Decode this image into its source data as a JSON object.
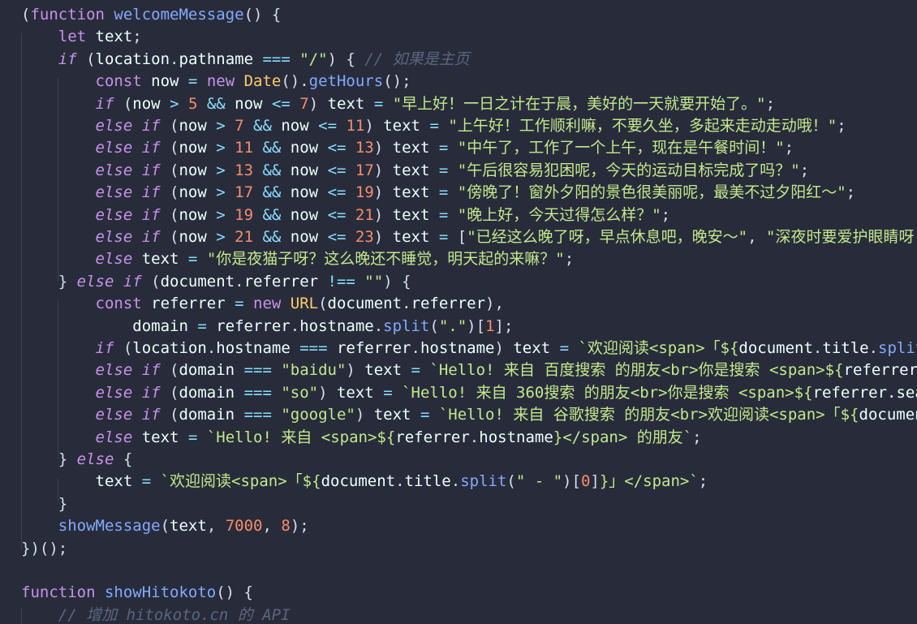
{
  "editor": {
    "language": "javascript",
    "colors": {
      "background": "#282c3a",
      "keyword": "#c792ea",
      "function": "#82aaff",
      "class": "#ffcb6b",
      "string": "#c3e88d",
      "number": "#f78c6c",
      "operator": "#89ddff",
      "comment": "#5c6580",
      "identifier": "#eeffff"
    },
    "lines": [
      [
        [
          "punc",
          "("
        ],
        [
          "kw",
          "function "
        ],
        [
          "fn",
          "welcomeMessage"
        ],
        [
          "punc",
          "() {"
        ]
      ],
      [
        [
          "kw",
          "    let "
        ],
        [
          "var",
          "text"
        ],
        [
          "punc",
          ";"
        ]
      ],
      [
        [
          "kwi",
          "    if "
        ],
        [
          "punc",
          "("
        ],
        [
          "var",
          "location"
        ],
        [
          "punc",
          "."
        ],
        [
          "prop",
          "pathname "
        ],
        [
          "op",
          "=== "
        ],
        [
          "str",
          "\"/\""
        ],
        [
          "punc",
          ") { "
        ],
        [
          "cmt",
          "// 如果是主页"
        ]
      ],
      [
        [
          "kw",
          "        const "
        ],
        [
          "var",
          "now "
        ],
        [
          "op",
          "= "
        ],
        [
          "kw",
          "new "
        ],
        [
          "cls",
          "Date"
        ],
        [
          "punc",
          "()."
        ],
        [
          "fn",
          "getHours"
        ],
        [
          "punc",
          "();"
        ]
      ],
      [
        [
          "kwi",
          "        if "
        ],
        [
          "punc",
          "("
        ],
        [
          "var",
          "now "
        ],
        [
          "op",
          "> "
        ],
        [
          "num",
          "5 "
        ],
        [
          "op",
          "&& "
        ],
        [
          "var",
          "now "
        ],
        [
          "op",
          "<= "
        ],
        [
          "num",
          "7"
        ],
        [
          "punc",
          ") "
        ],
        [
          "var",
          "text "
        ],
        [
          "op",
          "= "
        ],
        [
          "str",
          "\"早上好！一日之计在于晨，美好的一天就要开始了。\""
        ],
        [
          "punc",
          ";"
        ]
      ],
      [
        [
          "kwi",
          "        else if "
        ],
        [
          "punc",
          "("
        ],
        [
          "var",
          "now "
        ],
        [
          "op",
          "> "
        ],
        [
          "num",
          "7 "
        ],
        [
          "op",
          "&& "
        ],
        [
          "var",
          "now "
        ],
        [
          "op",
          "<= "
        ],
        [
          "num",
          "11"
        ],
        [
          "punc",
          ") "
        ],
        [
          "var",
          "text "
        ],
        [
          "op",
          "= "
        ],
        [
          "str",
          "\"上午好！工作顺利嘛，不要久坐，多起来走动走动哦！\""
        ],
        [
          "punc",
          ";"
        ]
      ],
      [
        [
          "kwi",
          "        else if "
        ],
        [
          "punc",
          "("
        ],
        [
          "var",
          "now "
        ],
        [
          "op",
          "> "
        ],
        [
          "num",
          "11 "
        ],
        [
          "op",
          "&& "
        ],
        [
          "var",
          "now "
        ],
        [
          "op",
          "<= "
        ],
        [
          "num",
          "13"
        ],
        [
          "punc",
          ") "
        ],
        [
          "var",
          "text "
        ],
        [
          "op",
          "= "
        ],
        [
          "str",
          "\"中午了，工作了一个上午，现在是午餐时间！\""
        ],
        [
          "punc",
          ";"
        ]
      ],
      [
        [
          "kwi",
          "        else if "
        ],
        [
          "punc",
          "("
        ],
        [
          "var",
          "now "
        ],
        [
          "op",
          "> "
        ],
        [
          "num",
          "13 "
        ],
        [
          "op",
          "&& "
        ],
        [
          "var",
          "now "
        ],
        [
          "op",
          "<= "
        ],
        [
          "num",
          "17"
        ],
        [
          "punc",
          ") "
        ],
        [
          "var",
          "text "
        ],
        [
          "op",
          "= "
        ],
        [
          "str",
          "\"午后很容易犯困呢，今天的运动目标完成了吗？\""
        ],
        [
          "punc",
          ";"
        ]
      ],
      [
        [
          "kwi",
          "        else if "
        ],
        [
          "punc",
          "("
        ],
        [
          "var",
          "now "
        ],
        [
          "op",
          "> "
        ],
        [
          "num",
          "17 "
        ],
        [
          "op",
          "&& "
        ],
        [
          "var",
          "now "
        ],
        [
          "op",
          "<= "
        ],
        [
          "num",
          "19"
        ],
        [
          "punc",
          ") "
        ],
        [
          "var",
          "text "
        ],
        [
          "op",
          "= "
        ],
        [
          "str",
          "\"傍晚了！窗外夕阳的景色很美丽呢，最美不过夕阳红～\""
        ],
        [
          "punc",
          ";"
        ]
      ],
      [
        [
          "kwi",
          "        else if "
        ],
        [
          "punc",
          "("
        ],
        [
          "var",
          "now "
        ],
        [
          "op",
          "> "
        ],
        [
          "num",
          "19 "
        ],
        [
          "op",
          "&& "
        ],
        [
          "var",
          "now "
        ],
        [
          "op",
          "<= "
        ],
        [
          "num",
          "21"
        ],
        [
          "punc",
          ") "
        ],
        [
          "var",
          "text "
        ],
        [
          "op",
          "= "
        ],
        [
          "str",
          "\"晚上好，今天过得怎么样？\""
        ],
        [
          "punc",
          ";"
        ]
      ],
      [
        [
          "kwi",
          "        else if "
        ],
        [
          "punc",
          "("
        ],
        [
          "var",
          "now "
        ],
        [
          "op",
          "> "
        ],
        [
          "num",
          "21 "
        ],
        [
          "op",
          "&& "
        ],
        [
          "var",
          "now "
        ],
        [
          "op",
          "<= "
        ],
        [
          "num",
          "23"
        ],
        [
          "punc",
          ") "
        ],
        [
          "var",
          "text "
        ],
        [
          "op",
          "= "
        ],
        [
          "punc",
          "["
        ],
        [
          "str",
          "\"已经这么晚了呀，早点休息吧，晚安～\""
        ],
        [
          "punc",
          ", "
        ],
        [
          "str",
          "\"深夜时要爱护眼睛呀"
        ]
      ],
      [
        [
          "kwi",
          "        else "
        ],
        [
          "var",
          "text "
        ],
        [
          "op",
          "= "
        ],
        [
          "str",
          "\"你是夜猫子呀？这么晚还不睡觉，明天起的来嘛？\""
        ],
        [
          "punc",
          ";"
        ]
      ],
      [
        [
          "punc",
          "    } "
        ],
        [
          "kwi",
          "else if "
        ],
        [
          "punc",
          "("
        ],
        [
          "var",
          "document"
        ],
        [
          "punc",
          "."
        ],
        [
          "prop",
          "referrer "
        ],
        [
          "op",
          "!== "
        ],
        [
          "str",
          "\"\""
        ],
        [
          "punc",
          ") {"
        ]
      ],
      [
        [
          "kw",
          "        const "
        ],
        [
          "var",
          "referrer "
        ],
        [
          "op",
          "= "
        ],
        [
          "kw",
          "new "
        ],
        [
          "cls",
          "URL"
        ],
        [
          "punc",
          "("
        ],
        [
          "var",
          "document"
        ],
        [
          "punc",
          "."
        ],
        [
          "prop",
          "referrer"
        ],
        [
          "punc",
          "),"
        ]
      ],
      [
        [
          "var",
          "            domain "
        ],
        [
          "op",
          "= "
        ],
        [
          "var",
          "referrer"
        ],
        [
          "punc",
          "."
        ],
        [
          "prop",
          "hostname"
        ],
        [
          "punc",
          "."
        ],
        [
          "fn",
          "split"
        ],
        [
          "punc",
          "("
        ],
        [
          "str",
          "\".\""
        ],
        [
          "punc",
          ")["
        ],
        [
          "num",
          "1"
        ],
        [
          "punc",
          "];"
        ]
      ],
      [
        [
          "kwi",
          "        if "
        ],
        [
          "punc",
          "("
        ],
        [
          "var",
          "location"
        ],
        [
          "punc",
          "."
        ],
        [
          "prop",
          "hostname "
        ],
        [
          "op",
          "=== "
        ],
        [
          "var",
          "referrer"
        ],
        [
          "punc",
          "."
        ],
        [
          "prop",
          "hostname"
        ],
        [
          "punc",
          ") "
        ],
        [
          "var",
          "text "
        ],
        [
          "op",
          "= "
        ],
        [
          "tpl",
          "`欢迎阅读<span>「${"
        ],
        [
          "var",
          "document"
        ],
        [
          "punc",
          "."
        ],
        [
          "prop",
          "title"
        ],
        [
          "punc",
          "."
        ],
        [
          "fn",
          "split"
        ],
        [
          "punc",
          "("
        ],
        [
          "str",
          "\""
        ]
      ],
      [
        [
          "kwi",
          "        else if "
        ],
        [
          "punc",
          "("
        ],
        [
          "var",
          "domain "
        ],
        [
          "op",
          "=== "
        ],
        [
          "str",
          "\"baidu\""
        ],
        [
          "punc",
          ") "
        ],
        [
          "var",
          "text "
        ],
        [
          "op",
          "= "
        ],
        [
          "tpl",
          "`Hello! 来自 百度搜索 的朋友<br>你是搜索 <span>${"
        ],
        [
          "var",
          "referrer.s"
        ]
      ],
      [
        [
          "kwi",
          "        else if "
        ],
        [
          "punc",
          "("
        ],
        [
          "var",
          "domain "
        ],
        [
          "op",
          "=== "
        ],
        [
          "str",
          "\"so\""
        ],
        [
          "punc",
          ") "
        ],
        [
          "var",
          "text "
        ],
        [
          "op",
          "= "
        ],
        [
          "tpl",
          "`Hello! 来自 360搜索 的朋友<br>你是搜索 <span>${"
        ],
        [
          "var",
          "referrer.searc"
        ]
      ],
      [
        [
          "kwi",
          "        else if "
        ],
        [
          "punc",
          "("
        ],
        [
          "var",
          "domain "
        ],
        [
          "op",
          "=== "
        ],
        [
          "str",
          "\"google\""
        ],
        [
          "punc",
          ") "
        ],
        [
          "var",
          "text "
        ],
        [
          "op",
          "= "
        ],
        [
          "tpl",
          "`Hello! 来自 谷歌搜索 的朋友<br>欢迎阅读<span>「${"
        ],
        [
          "var",
          "document"
        ]
      ],
      [
        [
          "kwi",
          "        else "
        ],
        [
          "var",
          "text "
        ],
        [
          "op",
          "= "
        ],
        [
          "tpl",
          "`Hello! 来自 <span>${"
        ],
        [
          "var",
          "referrer"
        ],
        [
          "punc",
          "."
        ],
        [
          "prop",
          "hostname"
        ],
        [
          "tpl",
          "}</span> 的朋友`"
        ],
        [
          "punc",
          ";"
        ]
      ],
      [
        [
          "punc",
          "    } "
        ],
        [
          "kwi",
          "else "
        ],
        [
          "punc",
          "{"
        ]
      ],
      [
        [
          "var",
          "        text "
        ],
        [
          "op",
          "= "
        ],
        [
          "tpl",
          "`欢迎阅读<span>「${"
        ],
        [
          "var",
          "document"
        ],
        [
          "punc",
          "."
        ],
        [
          "prop",
          "title"
        ],
        [
          "punc",
          "."
        ],
        [
          "fn",
          "split"
        ],
        [
          "punc",
          "("
        ],
        [
          "str",
          "\" - \""
        ],
        [
          "punc",
          ")["
        ],
        [
          "num",
          "0"
        ],
        [
          "punc",
          "]"
        ],
        [
          "tpl",
          "}」</span>`"
        ],
        [
          "punc",
          ";"
        ]
      ],
      [
        [
          "punc",
          "    }"
        ]
      ],
      [
        [
          "fn",
          "    showMessage"
        ],
        [
          "punc",
          "("
        ],
        [
          "var",
          "text"
        ],
        [
          "punc",
          ", "
        ],
        [
          "num",
          "7000"
        ],
        [
          "punc",
          ", "
        ],
        [
          "num",
          "8"
        ],
        [
          "punc",
          ");"
        ]
      ],
      [
        [
          "punc",
          "})();"
        ]
      ],
      [
        [
          "punc",
          ""
        ]
      ],
      [
        [
          "kw",
          "function "
        ],
        [
          "fn",
          "showHitokoto"
        ],
        [
          "punc",
          "() {"
        ]
      ],
      [
        [
          "cmt",
          "    // 增加 hitokoto.cn 的 API"
        ]
      ]
    ]
  }
}
